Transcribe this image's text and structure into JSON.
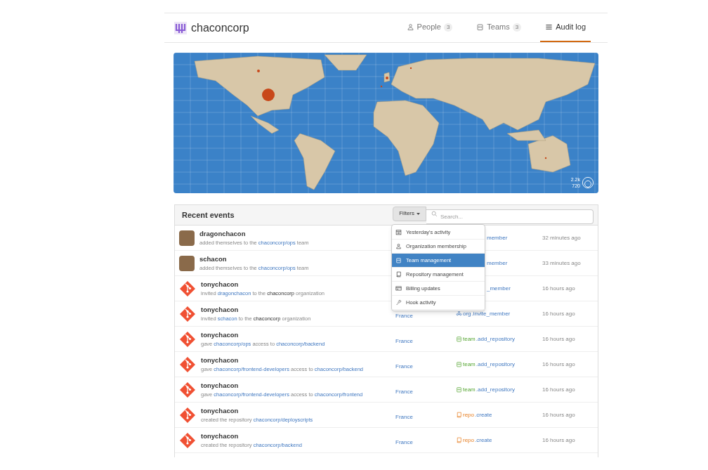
{
  "org": {
    "name": "chaconcorp"
  },
  "nav": [
    {
      "label": "People",
      "count": "3",
      "selected": false
    },
    {
      "label": "Teams",
      "count": "3",
      "selected": false
    },
    {
      "label": "Audit log",
      "selected": true
    }
  ],
  "map": {
    "legend": [
      "2.2k",
      "720"
    ]
  },
  "events": {
    "title": "Recent events",
    "filter_button": "Filters",
    "search": {
      "placeholder": "Search..."
    },
    "filter_menu": [
      {
        "label": "Yesterday's activity",
        "selected": false
      },
      {
        "label": "Organization membership",
        "selected": false
      },
      {
        "label": "Team management",
        "selected": true
      },
      {
        "label": "Repository management",
        "selected": false
      },
      {
        "label": "Billing updates",
        "selected": false
      },
      {
        "label": "Hook activity",
        "selected": false
      }
    ],
    "rows": [
      {
        "user": "dragonchacon",
        "kind": "photo",
        "parts": [
          {
            "t": "added themselves to the "
          },
          {
            "t": "chaconcorp/ops",
            "kind": "link"
          },
          {
            "t": " team"
          }
        ],
        "action": {
          "kind": "partial",
          "text": "member"
        },
        "time": "32 minutes ago"
      },
      {
        "user": "schacon",
        "kind": "photo",
        "parts": [
          {
            "t": "added themselves to the "
          },
          {
            "t": "chaconcorp/ops",
            "kind": "link"
          },
          {
            "t": " team"
          }
        ],
        "action": {
          "kind": "partial",
          "text": "member"
        },
        "time": "33 minutes ago"
      },
      {
        "user": "tonychacon",
        "kind": "git",
        "parts": [
          {
            "t": "invited "
          },
          {
            "t": "dragonchacon",
            "kind": "link"
          },
          {
            "t": " to the "
          },
          {
            "t": "chaconcorp",
            "kind": "strong"
          },
          {
            "t": " organization"
          }
        ],
        "action": {
          "kind": "partial",
          "text": "_member"
        },
        "time": "16 hours ago"
      },
      {
        "user": "tonychacon",
        "kind": "git",
        "parts": [
          {
            "t": "invited "
          },
          {
            "t": "schacon",
            "kind": "link"
          },
          {
            "t": " to the "
          },
          {
            "t": "chaconcorp",
            "kind": "strong"
          },
          {
            "t": " organization"
          }
        ],
        "location": "France",
        "action": {
          "kind": "org",
          "prefix": "org",
          "text": ".invite_member"
        },
        "time": "16 hours ago"
      },
      {
        "user": "tonychacon",
        "kind": "git",
        "parts": [
          {
            "t": "gave "
          },
          {
            "t": "chaconcorp/ops",
            "kind": "link"
          },
          {
            "t": " access to "
          },
          {
            "t": "chaconcorp/backend",
            "kind": "link"
          }
        ],
        "location": "France",
        "action": {
          "kind": "team",
          "prefix": "team",
          "text": ".add_repository"
        },
        "time": "16 hours ago"
      },
      {
        "user": "tonychacon",
        "kind": "git",
        "parts": [
          {
            "t": "gave "
          },
          {
            "t": "chaconcorp/frontend-developers",
            "kind": "link"
          },
          {
            "t": " access to "
          },
          {
            "t": "chaconcorp/backend",
            "kind": "link"
          }
        ],
        "location": "France",
        "action": {
          "kind": "team",
          "prefix": "team",
          "text": ".add_repository"
        },
        "time": "16 hours ago"
      },
      {
        "user": "tonychacon",
        "kind": "git",
        "parts": [
          {
            "t": "gave "
          },
          {
            "t": "chaconcorp/frontend-developers",
            "kind": "link"
          },
          {
            "t": " access to "
          },
          {
            "t": "chaconcorp/frontend",
            "kind": "link"
          }
        ],
        "location": "France",
        "action": {
          "kind": "team",
          "prefix": "team",
          "text": ".add_repository"
        },
        "time": "16 hours ago"
      },
      {
        "user": "tonychacon",
        "kind": "git",
        "parts": [
          {
            "t": "created the repository "
          },
          {
            "t": "chaconcorp/deployscripts",
            "kind": "link"
          }
        ],
        "location": "France",
        "action": {
          "kind": "repo",
          "prefix": "repo",
          "text": ".create"
        },
        "time": "16 hours ago"
      },
      {
        "user": "tonychacon",
        "kind": "git",
        "parts": [
          {
            "t": "created the repository "
          },
          {
            "t": "chaconcorp/backend",
            "kind": "link"
          }
        ],
        "location": "France",
        "action": {
          "kind": "repo",
          "prefix": "repo",
          "text": ".create"
        },
        "time": "16 hours ago"
      }
    ]
  }
}
